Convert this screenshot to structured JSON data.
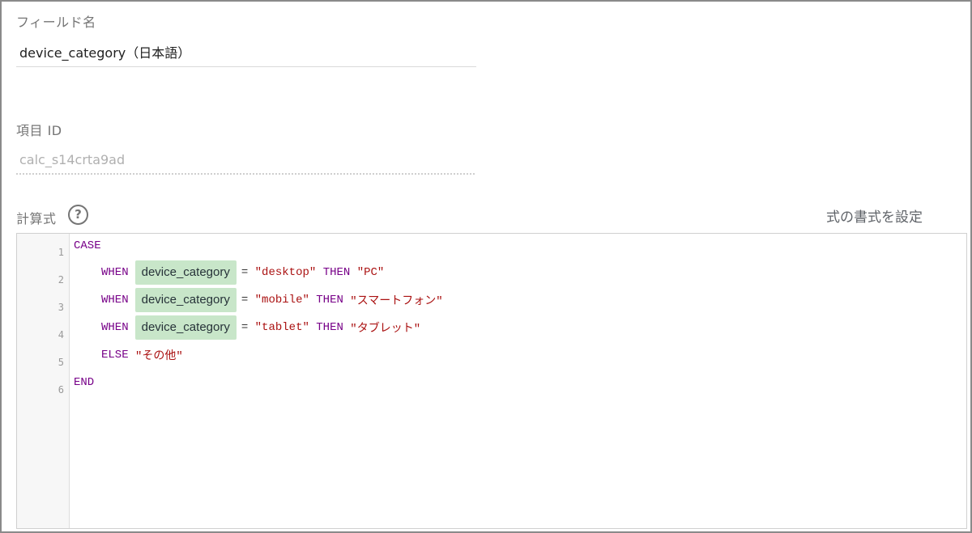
{
  "field_name": {
    "label": "フィールド名",
    "value": "device_category（日本語）"
  },
  "field_id": {
    "label": "項目 ID",
    "value": "calc_s14crta9ad"
  },
  "formula": {
    "label": "計算式",
    "help_glyph": "?",
    "format_link": "式の書式を設定",
    "line_numbers": [
      "1",
      "2",
      "3",
      "4",
      "5",
      "6"
    ],
    "lines": {
      "l1": {
        "kw": "CASE"
      },
      "l2": {
        "kw": "WHEN",
        "chip": "device_category",
        "eq": "=",
        "val": "\"desktop\"",
        "then": "THEN",
        "res": "\"PC\""
      },
      "l3": {
        "kw": "WHEN",
        "chip": "device_category",
        "eq": "=",
        "val": "\"mobile\"",
        "then": "THEN",
        "res": "\"スマートフォン\""
      },
      "l4": {
        "kw": "WHEN",
        "chip": "device_category",
        "eq": "=",
        "val": "\"tablet\"",
        "then": "THEN",
        "res": "\"タブレット\""
      },
      "l5": {
        "kw": "ELSE",
        "res": "\"その他\""
      },
      "l6": {
        "kw": "END"
      }
    }
  },
  "colors": {
    "keyword": "#770088",
    "string": "#aa1111",
    "chip_bg": "#c8e6c9"
  },
  "icons": {
    "help": "help-circle-icon"
  }
}
